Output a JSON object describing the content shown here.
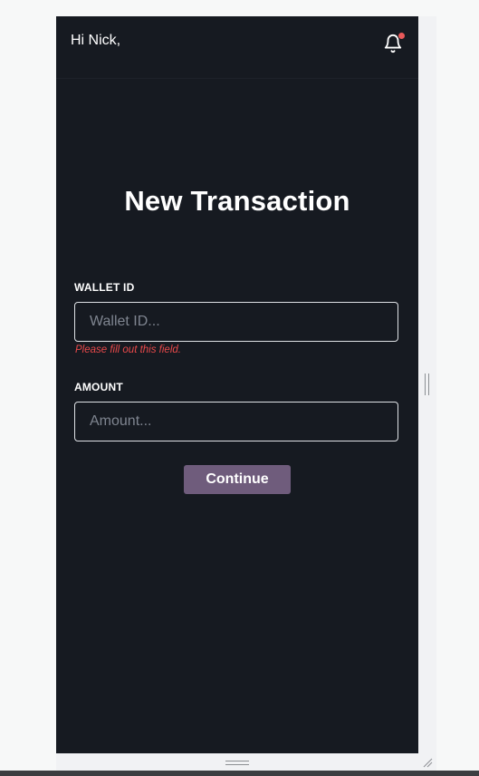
{
  "header": {
    "greeting": "Hi Nick,",
    "notification_icon": "bell-icon",
    "notification_badge_color": "#e8595a"
  },
  "form": {
    "title": "New Transaction",
    "wallet": {
      "label": "WALLET ID",
      "placeholder": "Wallet ID...",
      "value": "",
      "error": "Please fill out this field."
    },
    "amount": {
      "label": "AMOUNT",
      "placeholder": "Amount...",
      "value": ""
    },
    "continue_label": "Continue"
  },
  "colors": {
    "background": "#161a21",
    "button": "#6f5c7c",
    "error": "#e8494a"
  }
}
